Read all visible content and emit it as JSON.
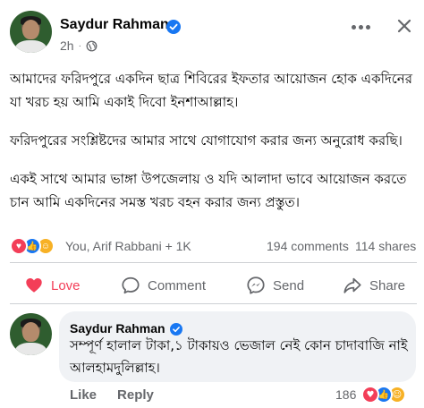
{
  "post": {
    "author": "Saydur Rahman",
    "time": "2h",
    "dot": "·",
    "paragraphs": [
      "আমাদের ফরিদপুরে একদিন ছাত্র শিবিরের ইফতার আয়োজন হোক একদিনের যা খরচ হয় আমি একাই দিবো ইনশাআল্লাহ।",
      "ফরিদপুরের সংশ্লিষ্টদের আমার সাথে যোগাযোগ করার জন্য অনুরোধ করছি।",
      "একই সাথে আমার ভাঙ্গা উপজেলায় ও যদি আলাদা ভাবে আয়োজন করতে চান আমি একদিনের সমস্ত খরচ বহন করার জন্য প্রস্তুত।"
    ]
  },
  "stats": {
    "reaction_names": "You, Arif Rabbani + 1K",
    "comments": "194 comments",
    "shares": "114 shares"
  },
  "actions": {
    "love": "Love",
    "comment": "Comment",
    "send": "Send",
    "share": "Share"
  },
  "comment": {
    "author": "Saydur Rahman",
    "text": "সম্পূর্ণ হালাল টাকা,১ টাকায়ও ভেজাল নেই কোন চাদাবাজি নাই আলহামদুলিল্লাহ।",
    "like_label": "Like",
    "reply_label": "Reply",
    "reaction_count": "186"
  },
  "icons": {
    "verified": "verified-badge-icon",
    "globe": "globe-icon",
    "more": "more-options-icon",
    "close": "close-icon",
    "love": "heart-icon",
    "comment": "comment-bubble-icon",
    "send": "messenger-send-icon",
    "share": "share-arrow-icon"
  },
  "colors": {
    "verified": "#1877f2",
    "love": "#f33e58",
    "like": "#1877f2",
    "care": "#f7b125",
    "secondary_text": "#65676b",
    "bubble": "#f0f2f5"
  }
}
